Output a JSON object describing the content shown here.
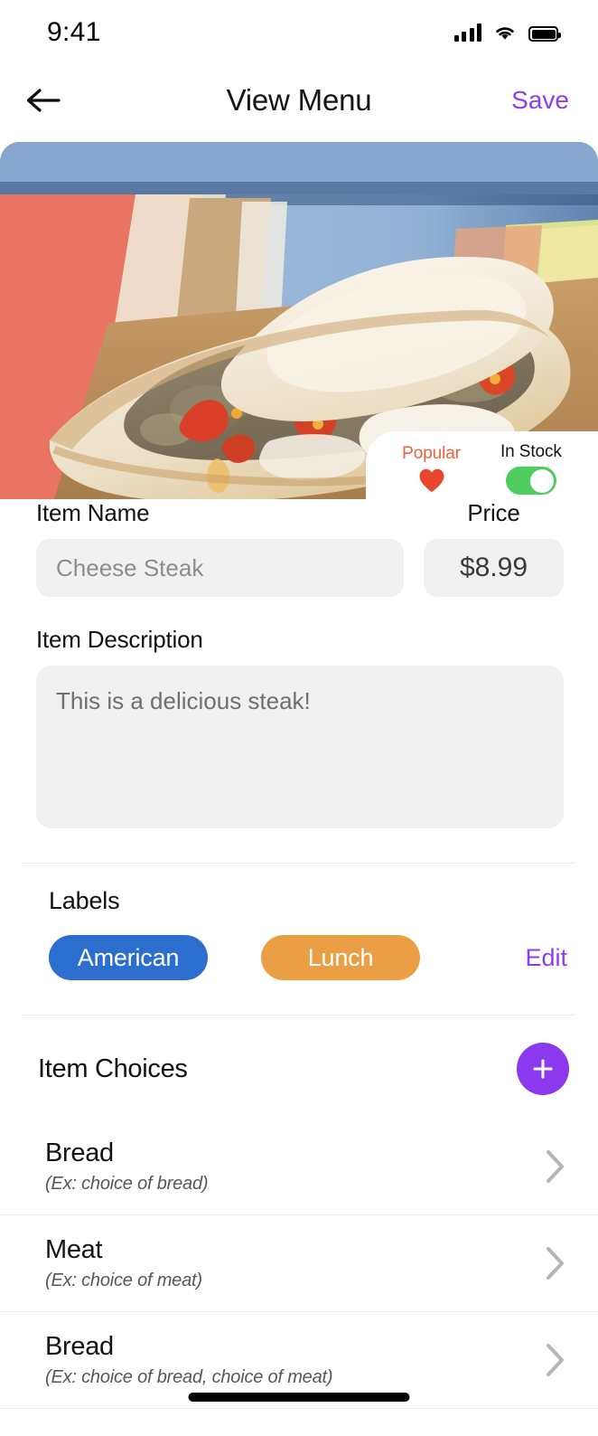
{
  "status_bar": {
    "time": "9:41",
    "icons": [
      "cellular-signal-icon",
      "wifi-icon",
      "battery-icon"
    ]
  },
  "header": {
    "back_icon": "arrow-left-icon",
    "title": "View Menu",
    "save_label": "Save"
  },
  "hero": {
    "image_alt": "cheese steak sandwich photo"
  },
  "badges": {
    "popular_label": "Popular",
    "popular_icon": "heart-icon",
    "in_stock_label": "In Stock",
    "in_stock_on": true
  },
  "form": {
    "item_name_label": "Item Name",
    "item_name_value": "Cheese Steak",
    "item_name_placeholder": "Cheese Steak",
    "price_label": "Price",
    "price_value": "$8.99",
    "description_label": "Item Description",
    "description_value": "This is a delicious steak!"
  },
  "labels_section": {
    "title": "Labels",
    "edit_label": "Edit",
    "pills": [
      {
        "text": "American",
        "color": "#2c6ecd"
      },
      {
        "text": "Lunch",
        "color": "#eb9f45"
      }
    ]
  },
  "item_choices": {
    "title": "Item Choices",
    "add_icon": "plus-icon",
    "rows": [
      {
        "title": "Bread",
        "subtitle": "(Ex: choice of bread)",
        "chevron": "chevron-right-icon"
      },
      {
        "title": "Meat",
        "subtitle": "(Ex: choice of meat)",
        "chevron": "chevron-right-icon"
      },
      {
        "title": "Bread",
        "subtitle": "(Ex: choice of bread, choice of meat)",
        "chevron": "chevron-right-icon"
      }
    ]
  },
  "colors": {
    "accent_purple": "#8b3df2",
    "toggle_green": "#4fcc5e",
    "popular_orange": "#e8623c",
    "heart_red": "#e8452e"
  }
}
